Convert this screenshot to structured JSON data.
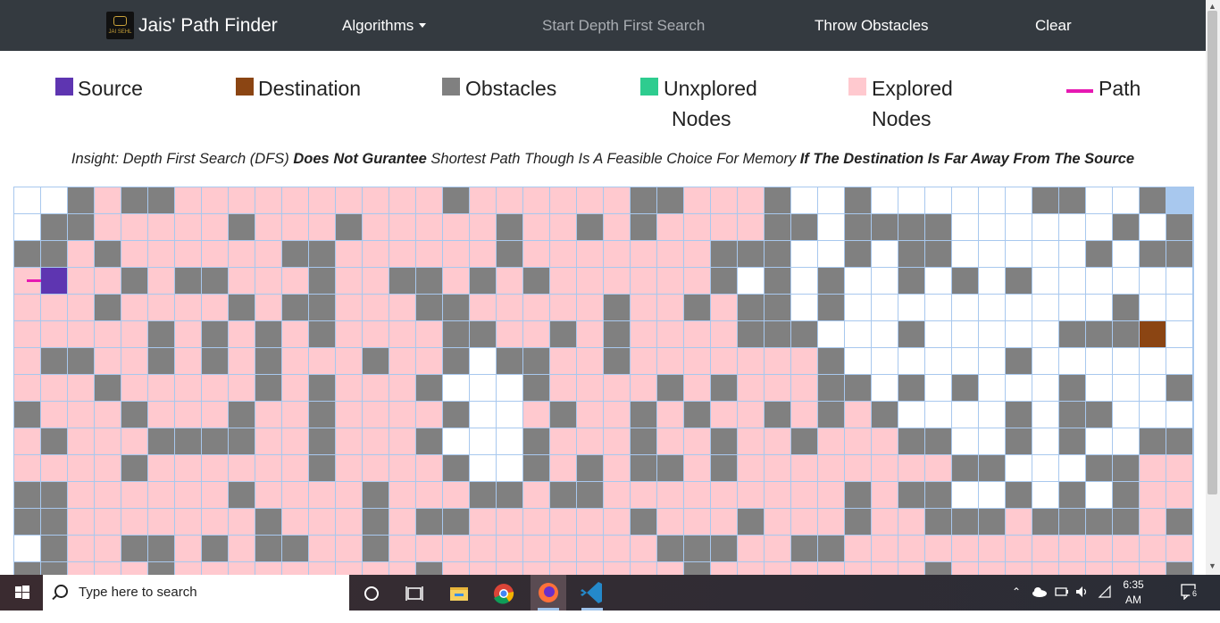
{
  "navbar": {
    "brand_logo_text": "JAI SEHL",
    "brand_label": "Jais' Path Finder",
    "algorithms_label": "Algorithms",
    "start_label": "Start Depth First Search",
    "throw_label": "Throw Obstacles",
    "clear_label": "Clear"
  },
  "legend": {
    "source": {
      "label": "Source",
      "color": "#5e35b1"
    },
    "destination": {
      "label": "Destination",
      "color": "#8b4513"
    },
    "obstacles": {
      "label": "Obstacles",
      "color": "#808080"
    },
    "unexplored": {
      "label": "Unxplored",
      "label2": "Nodes",
      "color": "#2ecc8f"
    },
    "explored": {
      "label": "Explored",
      "label2": "Nodes",
      "color": "#ffc9cf"
    },
    "path": {
      "label": "Path",
      "color": "#e619b2"
    }
  },
  "insight": {
    "p1": "Insight: Depth First Search (DFS) ",
    "b1": "Does Not Gurantee",
    "p2": " Shortest Path Though Is A Feasible Choice For Memory ",
    "b2": "If The Destination Is Far Away From The Source"
  },
  "grid": {
    "colors": {
      "o": "#808080",
      "e": "#ffc9cf",
      "u": "#ffffff",
      "s": "#5e35b1",
      "d": "#8b4513"
    },
    "rows": [
      "uuoeooeeeeeeeeeoeeeeeeeoeeeeeeeeeeeeeeoeeeeeeeeeeeeeeeeeeeeeeeeeeeeoouuuuuuoouuuuuuuuuuuuuuuuuuuuuuuuuu",
      "uooeeeeoeeeoeeeeeeoeeoeoeeeeeeeeeeeeeeooeooeeeeeeeoueooouuuuuuuueeeeeeeeeeeeeeeeeeeeeeeeeeeeeuuuuuuuuu",
      "ooeoeeeeeooeeeeeoeeeeeeeoeeeeeeoeooeoeeeeeeeeeeeeeeeeeeeeeeeeeeeeeeeeeeeeeeeeeeeeeeeeeeeeeeeeuuuuuuuu"
    ],
    "layout": [
      [
        "u",
        "u",
        "o",
        "e",
        "o",
        "o",
        "e",
        "e",
        "e",
        "e",
        "e",
        "e",
        "e",
        "e",
        "e",
        "e",
        "o",
        "e",
        "e",
        "e",
        "e",
        "e",
        "e",
        "o",
        "o",
        "e",
        "e",
        "e",
        "o",
        "u",
        "u",
        "o",
        "u",
        "u",
        "u",
        "u",
        "u",
        "u",
        "o",
        "o",
        "u",
        "u",
        "o"
      ],
      [
        "u",
        "o",
        "o",
        "e",
        "e",
        "e",
        "e",
        "e",
        "o",
        "e",
        "e",
        "e",
        "o",
        "e",
        "e",
        "e",
        "e",
        "e",
        "o",
        "e",
        "e",
        "o",
        "e",
        "o",
        "e",
        "e",
        "e",
        "e",
        "o",
        "o",
        "u",
        "o",
        "o",
        "o",
        "o",
        "u",
        "u",
        "u",
        "u",
        "u",
        "u",
        "o",
        "u",
        "o"
      ],
      [
        "o",
        "o",
        "e",
        "o",
        "e",
        "e",
        "e",
        "e",
        "e",
        "e",
        "o",
        "o",
        "e",
        "e",
        "e",
        "e",
        "e",
        "e",
        "o",
        "e",
        "e",
        "e",
        "e",
        "e",
        "e",
        "e",
        "o",
        "o",
        "o",
        "u",
        "u",
        "o",
        "u",
        "o",
        "o",
        "u",
        "u",
        "u",
        "u",
        "u",
        "o",
        "u",
        "o",
        "o"
      ],
      [
        "e",
        "s",
        "e",
        "e",
        "o",
        "e",
        "o",
        "o",
        "e",
        "e",
        "e",
        "o",
        "e",
        "e",
        "o",
        "o",
        "e",
        "o",
        "e",
        "o",
        "e",
        "e",
        "e",
        "e",
        "e",
        "e",
        "o",
        "u",
        "o",
        "u",
        "o",
        "u",
        "u",
        "o",
        "u",
        "o",
        "u",
        "o",
        "u",
        "u",
        "u",
        "u",
        "u",
        "u"
      ],
      [
        "e",
        "e",
        "e",
        "o",
        "e",
        "e",
        "e",
        "e",
        "o",
        "e",
        "o",
        "o",
        "e",
        "e",
        "e",
        "o",
        "o",
        "e",
        "e",
        "e",
        "e",
        "e",
        "o",
        "e",
        "e",
        "o",
        "e",
        "o",
        "o",
        "u",
        "o",
        "u",
        "u",
        "u",
        "u",
        "u",
        "u",
        "u",
        "u",
        "u",
        "u",
        "o",
        "u",
        "u"
      ],
      [
        "e",
        "e",
        "e",
        "e",
        "e",
        "o",
        "e",
        "o",
        "e",
        "o",
        "e",
        "o",
        "e",
        "e",
        "e",
        "e",
        "o",
        "o",
        "e",
        "e",
        "o",
        "e",
        "o",
        "e",
        "e",
        "e",
        "e",
        "o",
        "o",
        "o",
        "u",
        "u",
        "u",
        "o",
        "u",
        "u",
        "u",
        "u",
        "u",
        "o",
        "o",
        "o",
        "d",
        "u"
      ],
      [
        "e",
        "o",
        "o",
        "e",
        "e",
        "o",
        "e",
        "o",
        "e",
        "o",
        "e",
        "e",
        "e",
        "o",
        "e",
        "e",
        "o",
        "u",
        "o",
        "o",
        "e",
        "e",
        "o",
        "e",
        "e",
        "e",
        "e",
        "e",
        "e",
        "e",
        "o",
        "u",
        "u",
        "u",
        "u",
        "u",
        "u",
        "o",
        "u",
        "u",
        "u",
        "u",
        "u",
        "u"
      ],
      [
        "e",
        "e",
        "e",
        "o",
        "e",
        "e",
        "e",
        "e",
        "e",
        "o",
        "e",
        "o",
        "e",
        "e",
        "e",
        "o",
        "u",
        "u",
        "u",
        "o",
        "e",
        "e",
        "e",
        "e",
        "o",
        "e",
        "o",
        "e",
        "e",
        "e",
        "o",
        "o",
        "u",
        "o",
        "u",
        "o",
        "u",
        "u",
        "u",
        "o",
        "u",
        "u",
        "u",
        "o"
      ],
      [
        "o",
        "e",
        "e",
        "e",
        "o",
        "e",
        "e",
        "e",
        "o",
        "e",
        "e",
        "o",
        "e",
        "e",
        "e",
        "e",
        "o",
        "u",
        "u",
        "e",
        "o",
        "e",
        "e",
        "o",
        "e",
        "o",
        "e",
        "e",
        "o",
        "e",
        "o",
        "e",
        "o",
        "u",
        "u",
        "u",
        "u",
        "o",
        "u",
        "o",
        "o",
        "u",
        "u",
        "u"
      ],
      [
        "e",
        "o",
        "e",
        "e",
        "e",
        "o",
        "o",
        "o",
        "o",
        "e",
        "e",
        "o",
        "e",
        "e",
        "e",
        "o",
        "u",
        "u",
        "u",
        "o",
        "e",
        "e",
        "e",
        "o",
        "e",
        "e",
        "o",
        "e",
        "e",
        "o",
        "e",
        "e",
        "e",
        "o",
        "o",
        "u",
        "u",
        "o",
        "u",
        "o",
        "u",
        "u",
        "o",
        "o"
      ],
      [
        "e",
        "e",
        "e",
        "e",
        "o",
        "e",
        "e",
        "e",
        "e",
        "e",
        "e",
        "o",
        "e",
        "e",
        "e",
        "e",
        "o",
        "u",
        "u",
        "o",
        "e",
        "o",
        "e",
        "o",
        "o",
        "e",
        "o",
        "e",
        "e",
        "e",
        "e",
        "e",
        "e",
        "e",
        "e",
        "o",
        "o",
        "u",
        "u",
        "u",
        "o",
        "o",
        "e",
        "e"
      ],
      [
        "o",
        "o",
        "e",
        "e",
        "e",
        "e",
        "e",
        "e",
        "o",
        "e",
        "e",
        "e",
        "e",
        "o",
        "e",
        "e",
        "e",
        "o",
        "o",
        "e",
        "o",
        "o",
        "e",
        "e",
        "e",
        "e",
        "e",
        "e",
        "e",
        "e",
        "e",
        "o",
        "e",
        "o",
        "o",
        "u",
        "u",
        "o",
        "u",
        "o",
        "u",
        "o",
        "e",
        "e"
      ],
      [
        "o",
        "o",
        "e",
        "e",
        "e",
        "e",
        "e",
        "e",
        "e",
        "o",
        "e",
        "e",
        "e",
        "o",
        "e",
        "o",
        "o",
        "e",
        "e",
        "e",
        "e",
        "e",
        "e",
        "o",
        "e",
        "e",
        "e",
        "o",
        "e",
        "e",
        "e",
        "o",
        "e",
        "e",
        "o",
        "o",
        "o",
        "e",
        "o",
        "o",
        "o",
        "o",
        "e",
        "o"
      ],
      [
        "u",
        "o",
        "e",
        "e",
        "o",
        "o",
        "e",
        "o",
        "e",
        "o",
        "o",
        "e",
        "e",
        "o",
        "e",
        "e",
        "e",
        "e",
        "e",
        "e",
        "e",
        "e",
        "e",
        "e",
        "o",
        "o",
        "o",
        "e",
        "e",
        "o",
        "o",
        "e",
        "e",
        "e",
        "e",
        "e",
        "e",
        "e",
        "e",
        "e",
        "e",
        "e",
        "e",
        "e"
      ],
      [
        "o",
        "o",
        "e",
        "e",
        "e",
        "o",
        "e",
        "e",
        "e",
        "e",
        "e",
        "e",
        "e",
        "e",
        "e",
        "o",
        "e",
        "e",
        "e",
        "e",
        "e",
        "e",
        "e",
        "e",
        "e",
        "o",
        "e",
        "e",
        "e",
        "e",
        "e",
        "e",
        "e",
        "e",
        "o",
        "e",
        "e",
        "e",
        "e",
        "e",
        "e",
        "e",
        "e",
        "o"
      ]
    ]
  }
}
